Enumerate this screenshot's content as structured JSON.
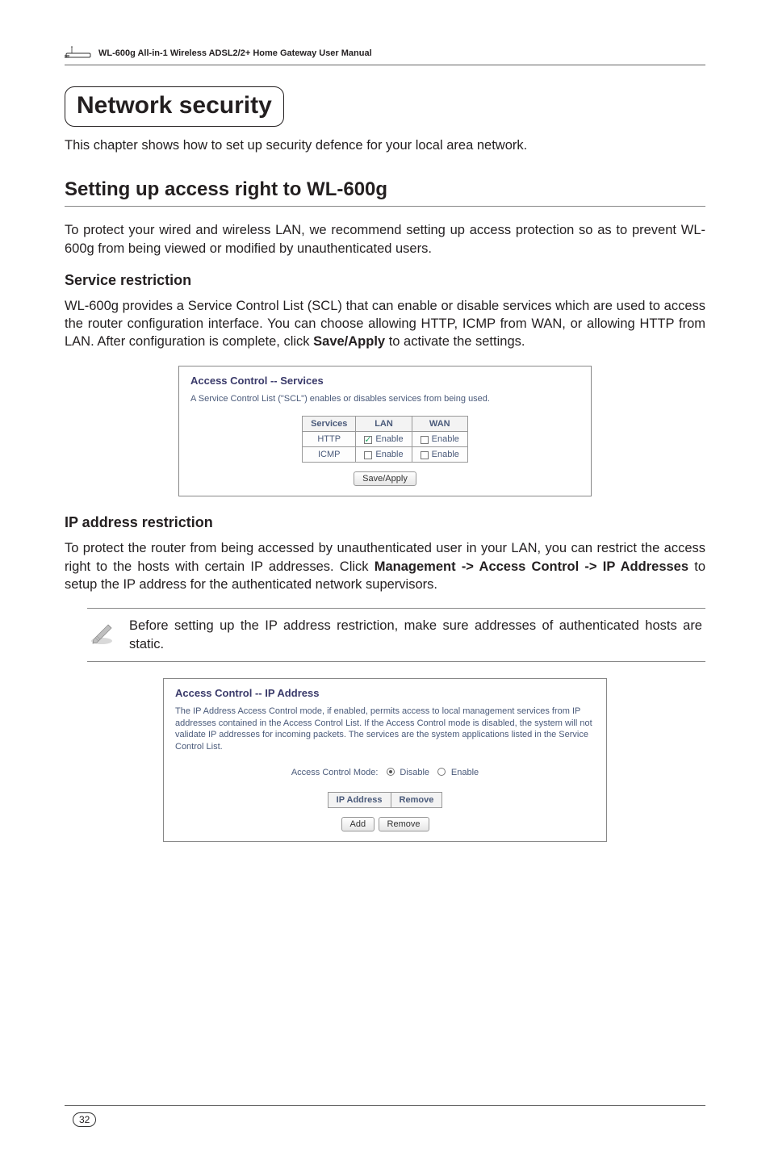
{
  "header": {
    "manual_title": "WL-600g All-in-1 Wireless ADSL2/2+ Home Gateway User Manual"
  },
  "chapter": {
    "title": "Network security",
    "intro": "This chapter shows how to set up security defence for your local area network."
  },
  "section": {
    "title": "Setting up access right to WL-600g",
    "para1": "To protect your wired and wireless LAN, we recommend setting up access protection so as to prevent WL-600g from being viewed or modified by unauthenticated users."
  },
  "sub1": {
    "title": "Service restriction",
    "para_before": "WL-600g provides a Service Control List (SCL) that can enable or disable services which are used to access the router configuration interface. You can choose allowing HTTP, ICMP from WAN, or allowing HTTP from LAN. After configuration is complete, click ",
    "para_bold": "Save/Apply",
    "para_after": " to activate the settings."
  },
  "screenshot1": {
    "title": "Access Control -- Services",
    "desc": "A Service Control List (\"SCL\") enables or disables services from being used.",
    "col_services": "Services",
    "col_lan": "LAN",
    "col_wan": "WAN",
    "row1_service": "HTTP",
    "row2_service": "ICMP",
    "enable_label": "Enable",
    "save_btn": "Save/Apply"
  },
  "sub2": {
    "title": "IP address restriction",
    "para_before": "To protect the router from being accessed by unauthenticated user in your LAN, you can restrict the access right to the hosts with certain IP addresses. Click ",
    "para_bold": "Management -> Access Control -> IP Addresses",
    "para_after": " to setup the IP address for the authenticated network supervisors."
  },
  "note": {
    "text": "Before setting up the IP address restriction, make sure addresses of authenticated hosts are static."
  },
  "screenshot2": {
    "title": "Access Control -- IP Address",
    "desc": "The IP Address Access Control mode, if enabled, permits access to local management services from IP addresses contained in the Access Control List. If the Access Control mode is disabled, the system will not validate IP addresses for incoming packets. The services are the system applications listed in the Service Control List.",
    "mode_label": "Access Control Mode:",
    "mode_opt_disable": "Disable",
    "mode_opt_enable": "Enable",
    "col_ip": "IP Address",
    "col_remove": "Remove",
    "add_btn": "Add",
    "remove_btn": "Remove"
  },
  "page_number": "32"
}
